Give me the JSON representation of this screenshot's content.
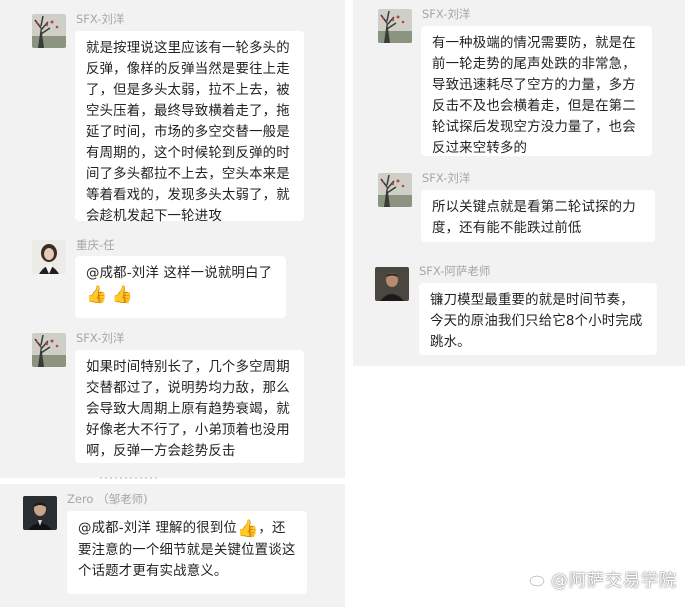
{
  "left_chat": {
    "messages": [
      {
        "sender": "SFX-刘洋",
        "text": "就是按理说这里应该有一轮多头的反弹，像样的反弹当然是要往上走了，但是多头太弱，拉不上去，被空头压着，最终导致横着走了，拖延了时间，市场的多空交替一般是有周期的，这个时候轮到反弹的时间了多头都拉不上去，空头本来是等着看戏的，发现多头太弱了，就会趁机发起下一轮进攻"
      },
      {
        "sender": "重庆-任",
        "mention": "@成都-刘洋",
        "text": " 这样一说就明白了",
        "emoji": [
          "👍",
          "👍"
        ]
      },
      {
        "sender": "SFX-刘洋",
        "text": "如果时间特别长了，几个多空周期交替都过了，说明势均力敌，那么会导致大周期上原有趋势衰竭，就好像老大不行了，小弟顶着也没用啊，反弹一方会趁势反击"
      },
      {
        "sender": "Zero （邹老师)",
        "mention": "@成都-刘洋",
        "text_a": " 理解的很到位",
        "emoji": "👍",
        "text_b": "，还要注意的一个细节就是关键位置谈这个话题才更有实战意义。"
      }
    ]
  },
  "right_chat": {
    "messages": [
      {
        "sender": "SFX-刘洋",
        "text": "有一种极端的情况需要防，就是在前一轮走势的尾声处跌的非常急，导致迅速耗尽了空方的力量，多方反击不及也会横着走，但是在第二轮试探后发现空方没力量了，也会反过来空转多的"
      },
      {
        "sender": "SFX-刘洋",
        "text": " 所以关键点就是看第二轮试探的力度，还有能不能跌过前低"
      },
      {
        "sender": "SFX-阿萨老师",
        "text": "镰刀模型最重要的就是时间节奏，今天的原油我们只给它8个小时完成跳水。"
      }
    ]
  },
  "watermark": {
    "icon": "weibo-icon",
    "text": "@阿萨交易学院"
  },
  "colors": {
    "panel_bg": "#f2f2f2",
    "bubble_bg": "#ffffff",
    "name_text": "#a6a6a6",
    "message_text": "#222222"
  }
}
